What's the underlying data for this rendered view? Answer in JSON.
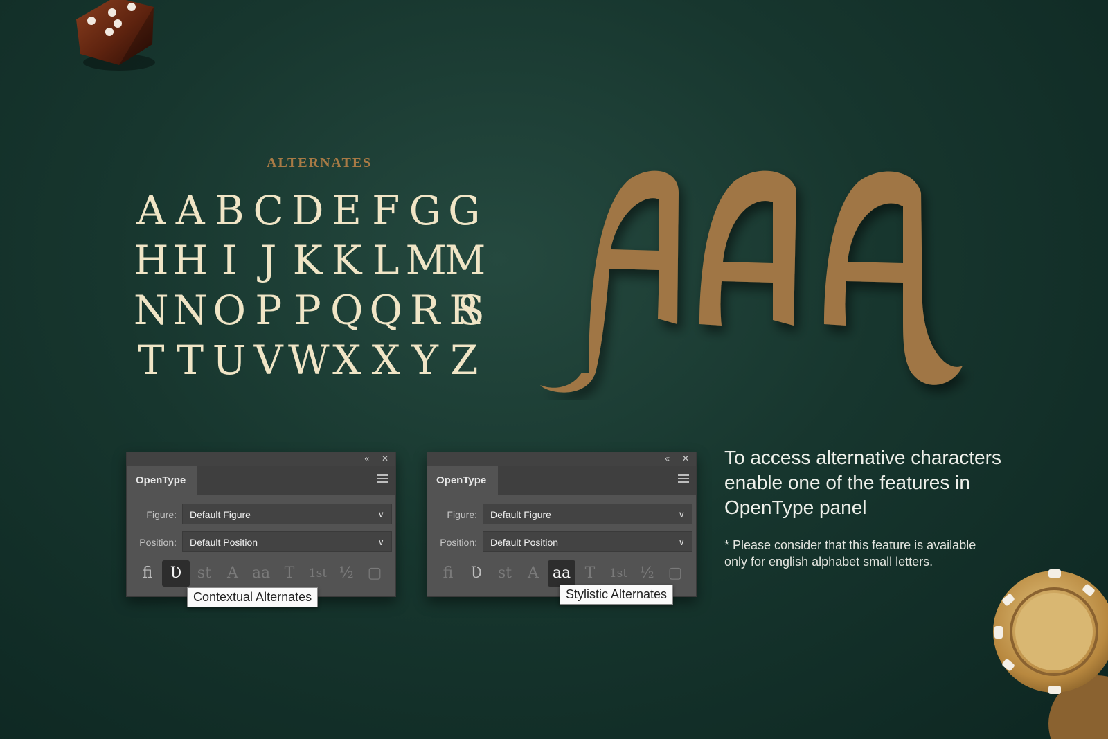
{
  "heading": "ALTERNATES",
  "glyph_rows": [
    [
      "A",
      "A",
      "B",
      "C",
      "D",
      "E",
      "F",
      "G",
      "G"
    ],
    [
      "H",
      "H",
      "I",
      "J",
      "K",
      "K",
      "L",
      "M",
      "M"
    ],
    [
      "N",
      "N",
      "O",
      "P",
      "P",
      "Q",
      "Q",
      "R",
      "R",
      "S"
    ],
    [
      "T",
      "T",
      "U",
      "V",
      "W",
      "X",
      "X",
      "Y",
      "Z"
    ]
  ],
  "big_letters": [
    "A",
    "A",
    "A"
  ],
  "colors": {
    "accent": "#a87a45",
    "glyph": "#f0e5c6",
    "background": "#17362e"
  },
  "panels": [
    {
      "tab": "OpenType",
      "figure_label": "Figure:",
      "figure_value": "Default Figure",
      "position_label": "Position:",
      "position_value": "Default Position",
      "tooltip": "Contextual Alternates",
      "active_icon": "contextual-alternates"
    },
    {
      "tab": "OpenType",
      "figure_label": "Figure:",
      "figure_value": "Default Figure",
      "position_label": "Position:",
      "position_value": "Default Position",
      "tooltip": "Stylistic Alternates",
      "active_icon": "stylistic-alternates"
    }
  ],
  "icons": [
    {
      "name": "standard-ligatures",
      "glyph": "fi"
    },
    {
      "name": "contextual-alternates",
      "glyph": "Ʋ"
    },
    {
      "name": "discretionary-ligatures",
      "glyph": "st"
    },
    {
      "name": "swash",
      "glyph": "A"
    },
    {
      "name": "stylistic-alternates",
      "glyph": "aa"
    },
    {
      "name": "titling-alternates",
      "glyph": "T"
    },
    {
      "name": "ordinals",
      "glyph": "1st"
    },
    {
      "name": "fractions",
      "glyph": "½"
    },
    {
      "name": "more",
      "glyph": "▢"
    }
  ],
  "info": {
    "main": "To access alternative characters enable one of the features in OpenType panel",
    "note": "* Please  consider that this feature is available only for english alphabet small letters."
  }
}
